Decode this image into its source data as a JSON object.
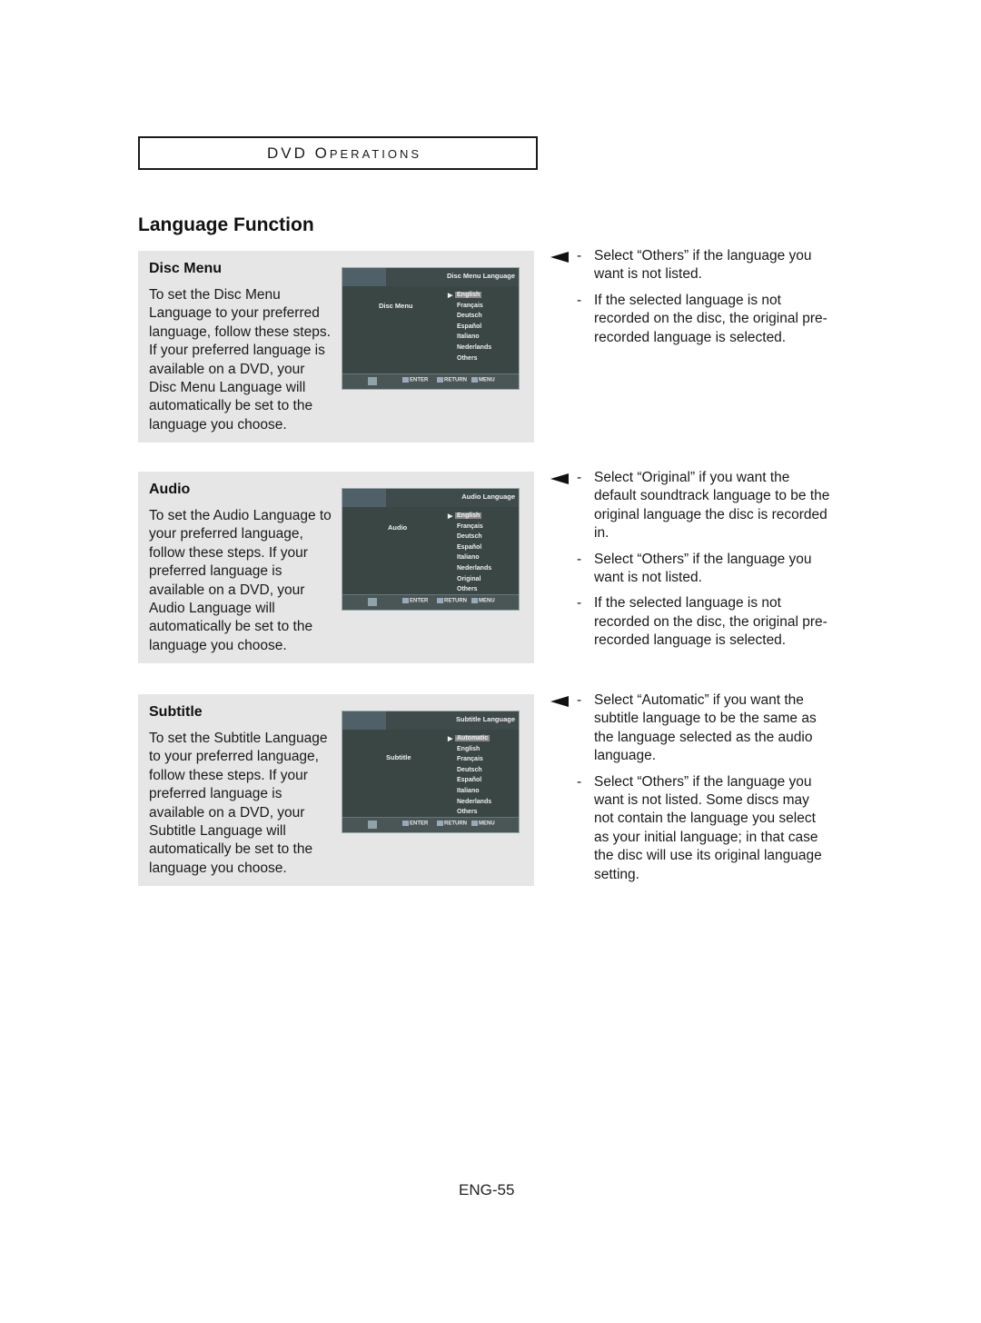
{
  "header": {
    "section_prefix": "DVD O",
    "section_rest": "PERATIONS"
  },
  "title": "Language Function",
  "sections": [
    {
      "heading": "Disc Menu",
      "body": "To set the Disc Menu Language to your preferred language, follow these steps. If your preferred language is available on a DVD, your Disc Menu Language will automatically be set to the language you choose.",
      "osd": {
        "title": "Disc Menu Language",
        "label": "Disc Menu",
        "options": [
          "English",
          "Français",
          "Deutsch",
          "Español",
          "Italiano",
          "Nederlands",
          "Others"
        ],
        "selected": "English",
        "buttons": [
          "ENTER",
          "RETURN",
          "MENU"
        ]
      },
      "notes": [
        "Select “Others” if the language you want is not listed.",
        "If the selected language is not recorded on the disc, the original pre-recorded language is selected."
      ]
    },
    {
      "heading": "Audio",
      "body": "To set the Audio Language to your preferred language, follow these steps. If your preferred language is available on a DVD, your Audio Language will automatically be set to the language you choose.",
      "osd": {
        "title": "Audio Language",
        "label": "Audio",
        "options": [
          "English",
          "Français",
          "Deutsch",
          "Español",
          "Italiano",
          "Nederlands",
          "Original",
          "Others"
        ],
        "selected": "English",
        "buttons": [
          "ENTER",
          "RETURN",
          "MENU"
        ]
      },
      "notes": [
        "Select “Original” if you want the default soundtrack language to be the original language the disc is recorded in.",
        "Select “Others” if the language you want is not listed.",
        "If the selected language is not recorded on the disc, the original pre-recorded language is selected."
      ]
    },
    {
      "heading": "Subtitle",
      "body": "To set the Subtitle Language to your preferred language, follow these steps. If your preferred language is available on a DVD, your Subtitle Language will automatically be set to the language you choose.",
      "osd": {
        "title": "Subtitle Language",
        "label": "Subtitle",
        "options": [
          "Automatic",
          "English",
          "Français",
          "Deutsch",
          "Español",
          "Italiano",
          "Nederlands",
          "Others"
        ],
        "selected": "Automatic",
        "buttons": [
          "ENTER",
          "RETURN",
          "MENU"
        ]
      },
      "notes": [
        "Select “Automatic” if you want the subtitle language to be the same as the language selected as the audio language.",
        "Select “Others” if the language you want is not listed. Some discs may not contain the language you select as your initial language; in that case the disc will use its original language setting."
      ]
    }
  ],
  "page_number": "ENG-55",
  "icons": {
    "note_pointer": "left-pointer-icon",
    "nav": "direction-pad-icon"
  }
}
